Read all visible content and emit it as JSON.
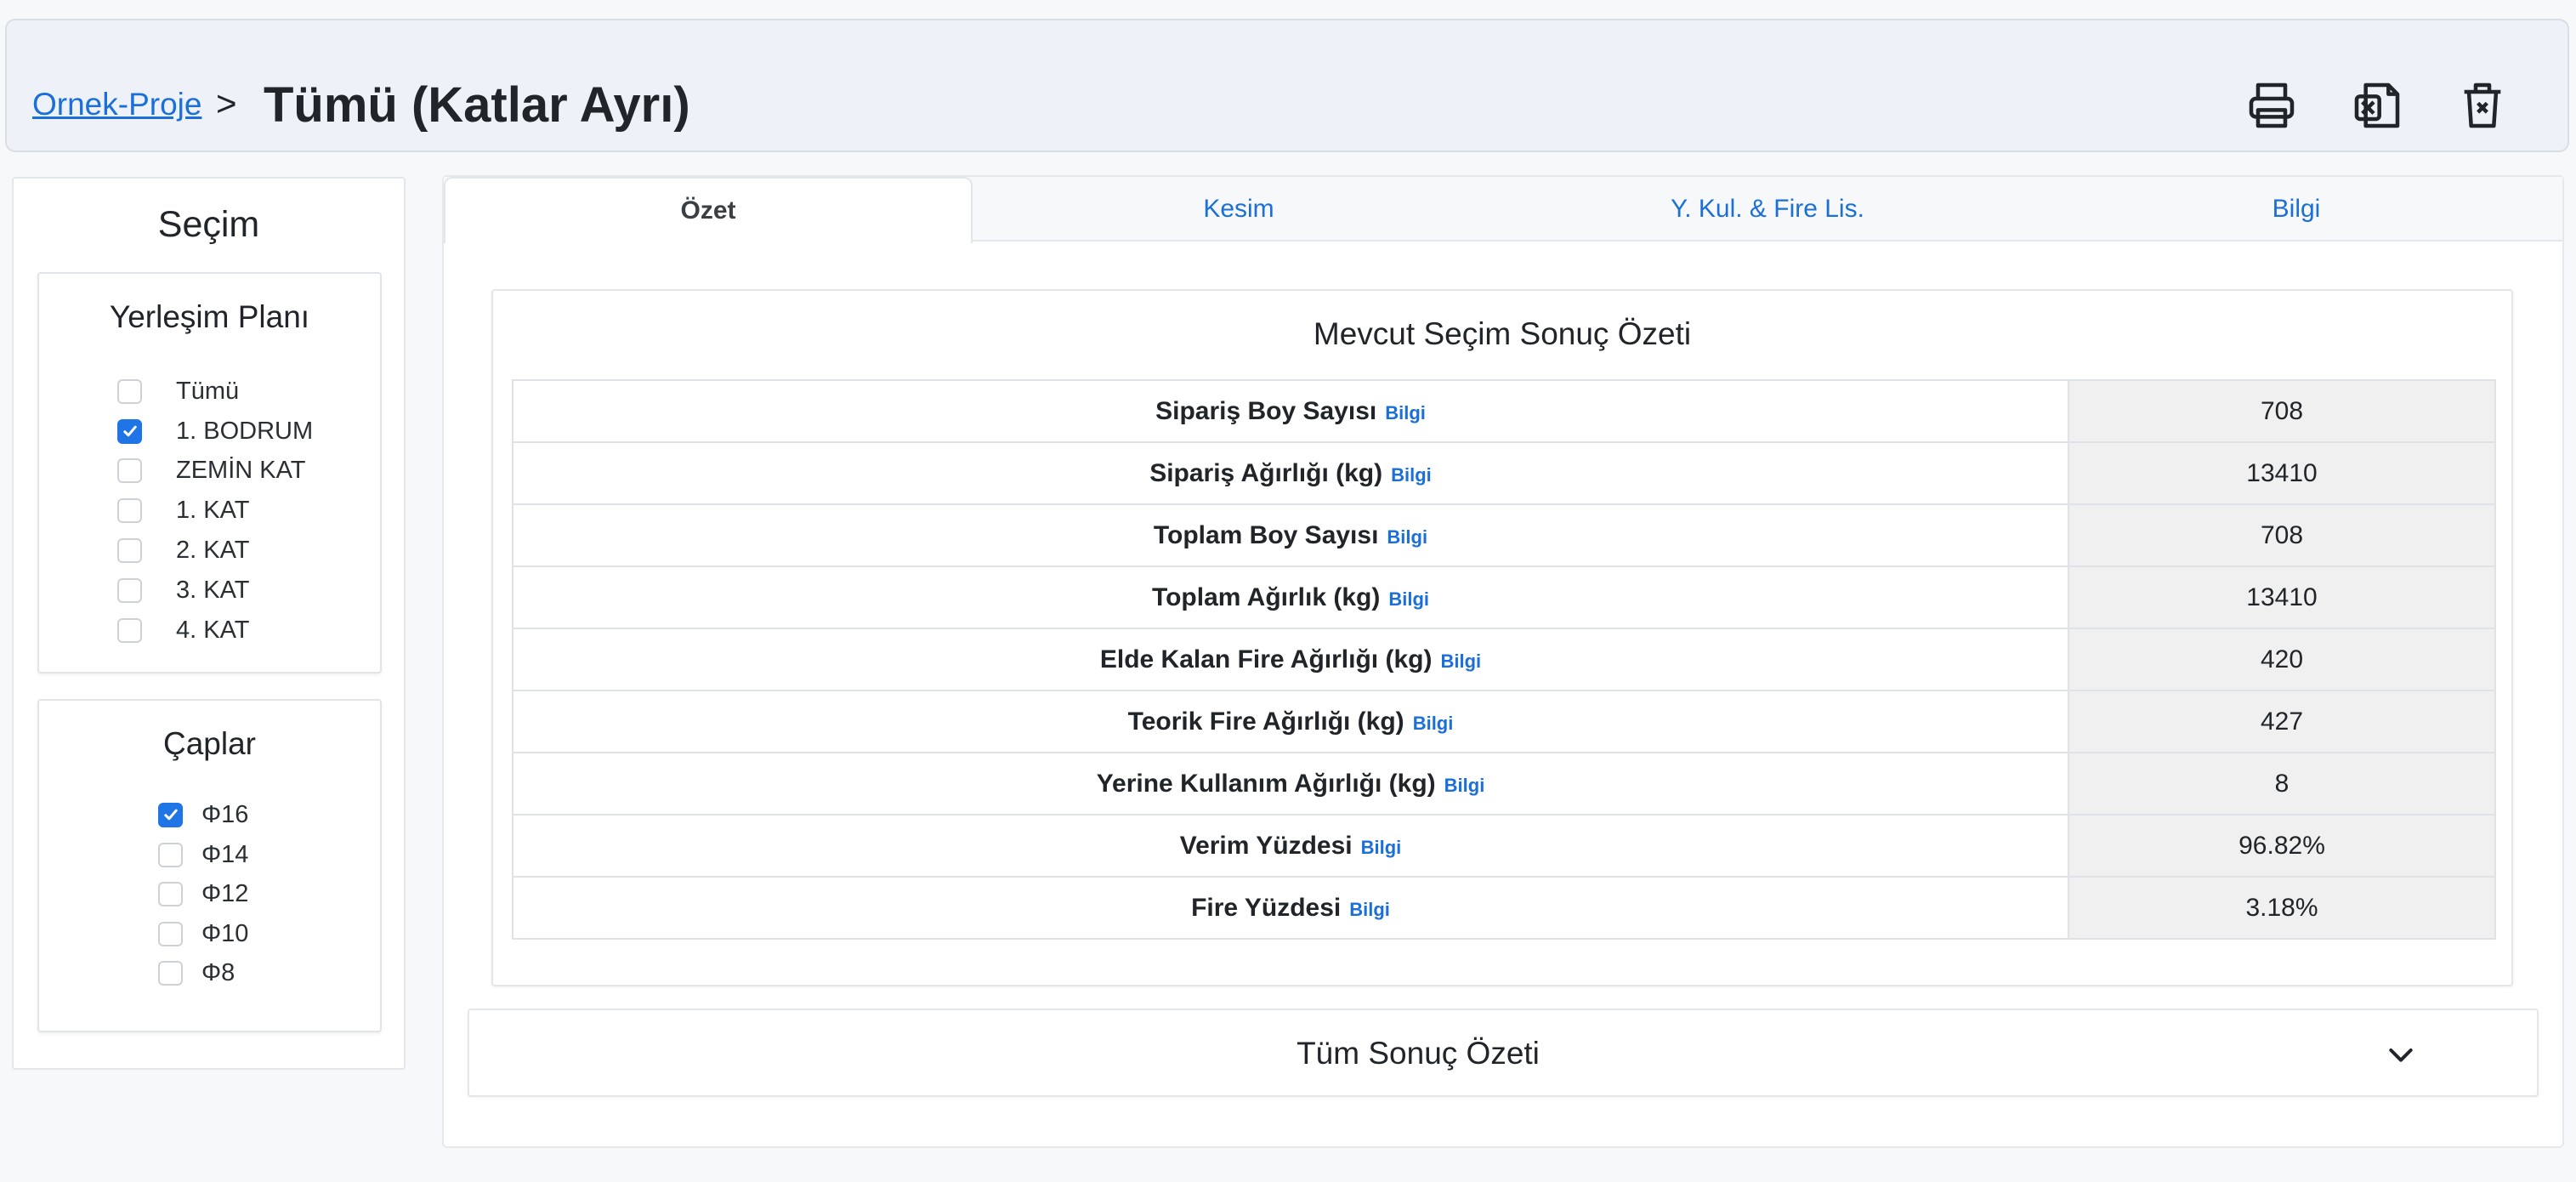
{
  "header": {
    "breadcrumb_link": "Ornek-Proje",
    "breadcrumb_sep": ">",
    "title": "Tümü (Katlar Ayrı)",
    "icons": [
      "printer-icon",
      "excel-file-icon",
      "trash-icon"
    ]
  },
  "sidebar": {
    "title": "Seçim",
    "layout_panel": {
      "title": "Yerleşim Planı",
      "options": [
        {
          "label": "Tümü",
          "checked": false
        },
        {
          "label": "1. BODRUM",
          "checked": true
        },
        {
          "label": "ZEMİN KAT",
          "checked": false
        },
        {
          "label": "1. KAT",
          "checked": false
        },
        {
          "label": "2. KAT",
          "checked": false
        },
        {
          "label": "3. KAT",
          "checked": false
        },
        {
          "label": "4. KAT",
          "checked": false
        }
      ]
    },
    "diameters_panel": {
      "title": "Çaplar",
      "options": [
        {
          "label": "Φ16",
          "checked": true
        },
        {
          "label": "Φ14",
          "checked": false
        },
        {
          "label": "Φ12",
          "checked": false
        },
        {
          "label": "Φ10",
          "checked": false
        },
        {
          "label": "Φ8",
          "checked": false
        }
      ]
    }
  },
  "tabs": [
    {
      "label": "Özet",
      "active": true
    },
    {
      "label": "Kesim",
      "active": false
    },
    {
      "label": "Y. Kul. & Fire Lis.",
      "active": false
    },
    {
      "label": "Bilgi",
      "active": false
    }
  ],
  "summary": {
    "title": "Mevcut Seçim Sonuç Özeti",
    "info_label": "Bilgi",
    "rows": [
      {
        "label": "Sipariş Boy Sayısı",
        "value": "708"
      },
      {
        "label": "Sipariş Ağırlığı (kg)",
        "value": "13410"
      },
      {
        "label": "Toplam Boy Sayısı",
        "value": "708"
      },
      {
        "label": "Toplam Ağırlık (kg)",
        "value": "13410"
      },
      {
        "label": "Elde Kalan Fire Ağırlığı (kg)",
        "value": "420"
      },
      {
        "label": "Teorik Fire Ağırlığı (kg)",
        "value": "427"
      },
      {
        "label": "Yerine Kullanım Ağırlığı (kg)",
        "value": "8"
      },
      {
        "label": "Verim Yüzdesi",
        "value": "96.82%"
      },
      {
        "label": "Fire Yüzdesi",
        "value": "3.18%"
      }
    ]
  },
  "all_summary": {
    "label": "Tüm Sonuç Özeti"
  },
  "colors": {
    "accent": "#1f74e6",
    "link": "#1a6fd8",
    "header_bg": "#eef2f8",
    "value_cell_bg": "#f0f0f0"
  }
}
